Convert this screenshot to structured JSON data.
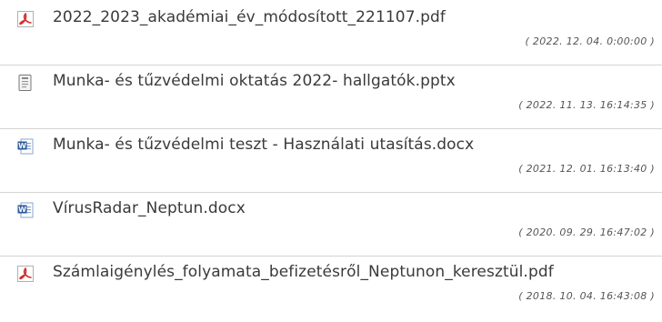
{
  "files": [
    {
      "name": "2022_2023_akadémiai_év_módosított_221107.pdf",
      "date": "( 2022. 12. 04. 0:00:00 )",
      "icon": "pdf-icon"
    },
    {
      "name": "Munka- és tűzvédelmi oktatás 2022- hallgatók.pptx",
      "date": "( 2022. 11. 13. 16:14:35 )",
      "icon": "generic-file-icon"
    },
    {
      "name": "Munka- és tűzvédelmi teszt - Használati utasítás.docx",
      "date": "( 2021. 12. 01. 16:13:40 )",
      "icon": "word-document-icon"
    },
    {
      "name": "VírusRadar_Neptun.docx",
      "date": "( 2020. 09. 29. 16:47:02 )",
      "icon": "word-document-icon"
    },
    {
      "name": "Számlaigénylés_folyamata_befizetésről_Neptunon_keresztül.pdf",
      "date": "( 2018. 10. 04. 16:43:08 )",
      "icon": "pdf-icon"
    }
  ],
  "colors": {
    "text": "#3a3a3a",
    "date": "#555555",
    "separator": "#d4d4d4",
    "pdf_red": "#d32f2f",
    "word_blue": "#2b579a"
  }
}
